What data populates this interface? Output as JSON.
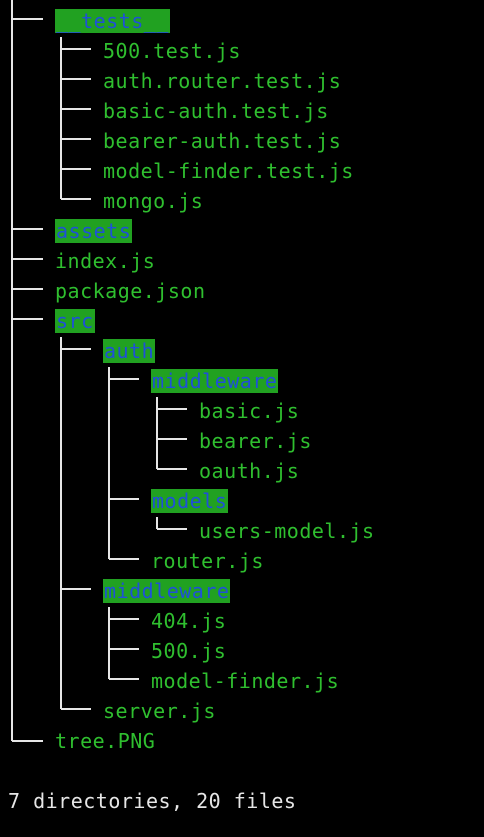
{
  "tree": [
    {
      "label": "__tests__",
      "type": "dir"
    },
    {
      "label": "500.test.js",
      "type": "file"
    },
    {
      "label": "auth.router.test.js",
      "type": "file"
    },
    {
      "label": "basic-auth.test.js",
      "type": "file"
    },
    {
      "label": "bearer-auth.test.js",
      "type": "file"
    },
    {
      "label": "model-finder.test.js",
      "type": "file"
    },
    {
      "label": "mongo.js",
      "type": "file"
    },
    {
      "label": "assets",
      "type": "dir"
    },
    {
      "label": "index.js",
      "type": "file"
    },
    {
      "label": "package.json",
      "type": "file"
    },
    {
      "label": "src",
      "type": "dir"
    },
    {
      "label": "auth",
      "type": "dir"
    },
    {
      "label": "middleware",
      "type": "dir"
    },
    {
      "label": "basic.js",
      "type": "file"
    },
    {
      "label": "bearer.js",
      "type": "file"
    },
    {
      "label": "oauth.js",
      "type": "file"
    },
    {
      "label": "models",
      "type": "dir"
    },
    {
      "label": "users-model.js",
      "type": "file"
    },
    {
      "label": "router.js",
      "type": "file"
    },
    {
      "label": "middleware",
      "type": "dir"
    },
    {
      "label": "404.js",
      "type": "file"
    },
    {
      "label": "500.js",
      "type": "file"
    },
    {
      "label": "model-finder.js",
      "type": "file"
    },
    {
      "label": "server.js",
      "type": "file"
    },
    {
      "label": "tree.PNG",
      "type": "file"
    }
  ],
  "summary": "7 directories, 20 files",
  "colors": {
    "file_text": "#2fbf2f",
    "dir_background": "#21a121",
    "dir_text": "#1f50d8",
    "tree_lines": "#e6e6e6",
    "background": "#000000"
  }
}
